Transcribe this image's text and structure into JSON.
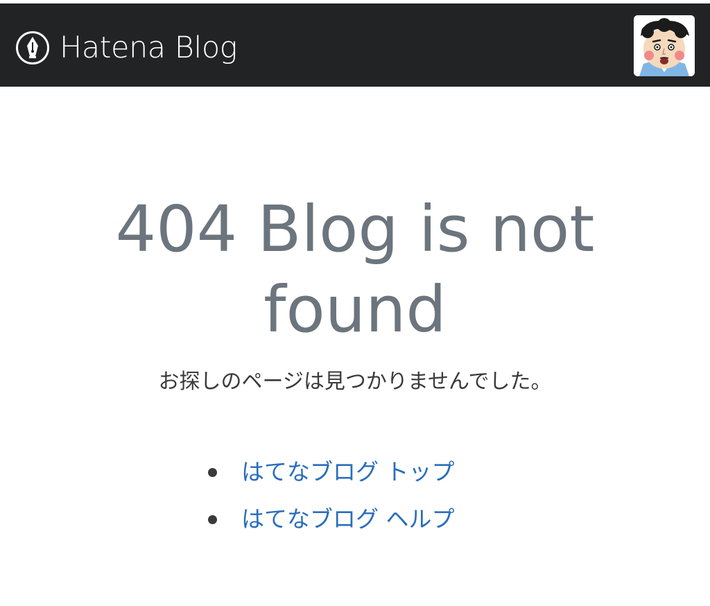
{
  "header": {
    "brand_name": "Hatena Blog",
    "brand_icon": "fountain-pen-icon",
    "avatar_icon": "user-avatar-icon",
    "background_color": "#222325"
  },
  "error": {
    "title": "404 Blog is not found",
    "message": "お探しのページは見つかりませんでした。",
    "title_color": "#6c757d"
  },
  "links": [
    {
      "label": "はてなブログ トップ"
    },
    {
      "label": "はてなブログ ヘルプ"
    }
  ],
  "colors": {
    "link": "#2a6ebb",
    "text": "#3a3a3a"
  }
}
